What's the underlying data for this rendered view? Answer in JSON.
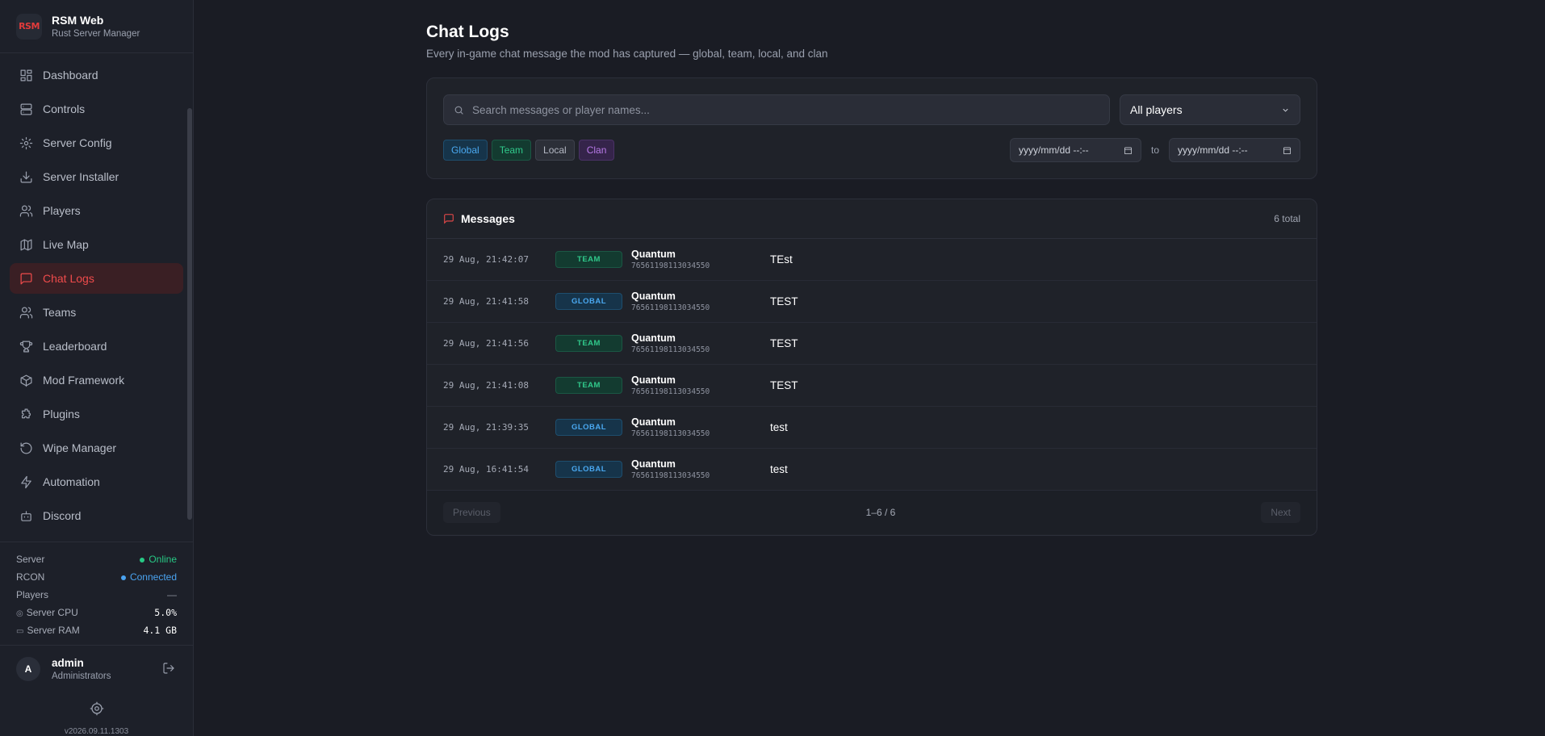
{
  "brand": {
    "logo": "RSM",
    "title": "RSM Web",
    "subtitle": "Rust Server Manager"
  },
  "nav": [
    {
      "label": "Dashboard",
      "icon": "dashboard-icon"
    },
    {
      "label": "Controls",
      "icon": "server-icon"
    },
    {
      "label": "Server Config",
      "icon": "gear-icon"
    },
    {
      "label": "Server Installer",
      "icon": "download-icon"
    },
    {
      "label": "Players",
      "icon": "users-icon"
    },
    {
      "label": "Live Map",
      "icon": "map-icon"
    },
    {
      "label": "Chat Logs",
      "icon": "chat-icon",
      "active": true
    },
    {
      "label": "Teams",
      "icon": "users-icon"
    },
    {
      "label": "Leaderboard",
      "icon": "trophy-icon"
    },
    {
      "label": "Mod Framework",
      "icon": "box-icon"
    },
    {
      "label": "Plugins",
      "icon": "puzzle-icon"
    },
    {
      "label": "Wipe Manager",
      "icon": "refresh-icon"
    },
    {
      "label": "Automation",
      "icon": "bolt-icon"
    },
    {
      "label": "Discord",
      "icon": "bot-icon"
    }
  ],
  "status": {
    "server_label": "Server",
    "server_value": "Online",
    "rcon_label": "RCON",
    "rcon_value": "Connected",
    "players_label": "Players",
    "players_value": "—",
    "cpu_label": "Server CPU",
    "cpu_value": "5.0%",
    "ram_label": "Server RAM",
    "ram_value": "4.1 GB"
  },
  "user": {
    "initial": "A",
    "name": "admin",
    "role": "Administrators"
  },
  "version": "v2026.09.11.1303",
  "page": {
    "title": "Chat Logs",
    "subtitle": "Every in-game chat message the mod has captured — global, team, local, and clan"
  },
  "filters": {
    "search_placeholder": "Search messages or player names...",
    "player_select": "All players",
    "chips": {
      "global": "Global",
      "team": "Team",
      "local": "Local",
      "clan": "Clan"
    },
    "date_from": "yyyy/mm/dd --:--",
    "date_to": "yyyy/mm/dd --:--",
    "to_label": "to"
  },
  "messages": {
    "title": "Messages",
    "total": "6 total",
    "rows": [
      {
        "time": "29 Aug, 21:42:07",
        "channel": "TEAM",
        "player": "Quantum",
        "steamid": "76561198113034550",
        "text": "TEst"
      },
      {
        "time": "29 Aug, 21:41:58",
        "channel": "GLOBAL",
        "player": "Quantum",
        "steamid": "76561198113034550",
        "text": "TEST"
      },
      {
        "time": "29 Aug, 21:41:56",
        "channel": "TEAM",
        "player": "Quantum",
        "steamid": "76561198113034550",
        "text": "TEST"
      },
      {
        "time": "29 Aug, 21:41:08",
        "channel": "TEAM",
        "player": "Quantum",
        "steamid": "76561198113034550",
        "text": "TEST"
      },
      {
        "time": "29 Aug, 21:39:35",
        "channel": "GLOBAL",
        "player": "Quantum",
        "steamid": "76561198113034550",
        "text": "test"
      },
      {
        "time": "29 Aug, 16:41:54",
        "channel": "GLOBAL",
        "player": "Quantum",
        "steamid": "76561198113034550",
        "text": "test"
      }
    ],
    "pager": {
      "prev": "Previous",
      "count": "1–6 / 6",
      "next": "Next"
    }
  }
}
